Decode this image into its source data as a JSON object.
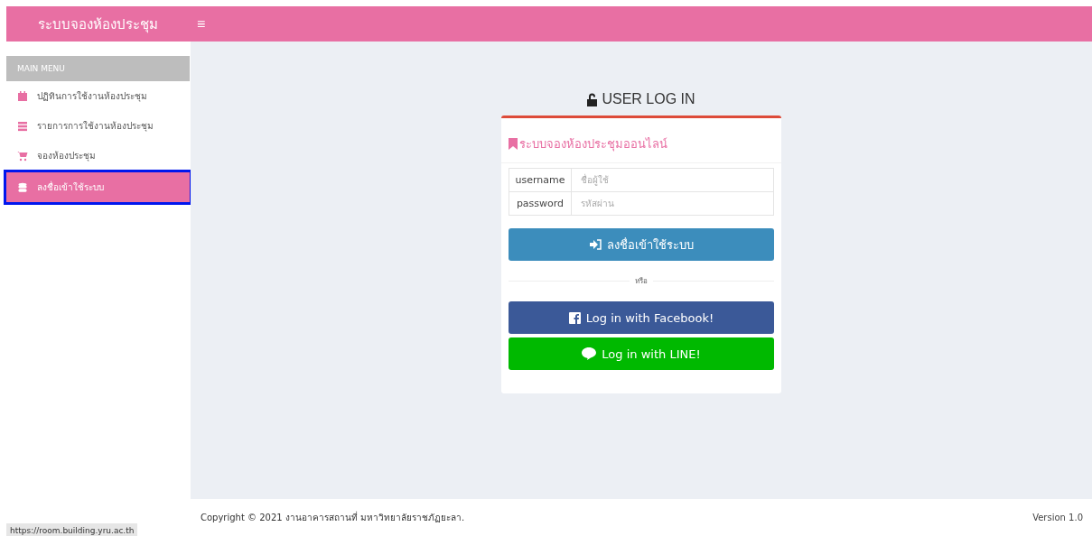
{
  "header": {
    "brand": "ระบบจองห้องประชุม",
    "menu_toggle": "≡"
  },
  "sidebar": {
    "heading": "MAIN MENU",
    "items": [
      {
        "label": "ปฏิทินการใช้งานห้องประชุม",
        "kind": "calendar",
        "selected": false
      },
      {
        "label": "รายการการใช้งานห้องประชุม",
        "kind": "list",
        "selected": false
      },
      {
        "label": "จองห้องประชุม",
        "kind": "cart",
        "selected": false
      },
      {
        "label": "ลงชื่อเข้าใช้ระบบ",
        "kind": "database",
        "selected": true
      }
    ]
  },
  "login": {
    "title": "USER LOG IN",
    "subtitle": "ระบบจองห้องประชุมออนไลน์",
    "fields": [
      {
        "label": "username",
        "placeholder": "ชื่อผู้ใช้"
      },
      {
        "label": "password",
        "placeholder": "รหัสผ่าน"
      }
    ],
    "submit": "ลงชื่อเข้าใช้ระบบ",
    "divider": "หรือ",
    "social": [
      {
        "kind": "facebook",
        "label": "Log in with Facebook!"
      },
      {
        "kind": "line",
        "label": "Log in with LINE!"
      }
    ]
  },
  "footer": {
    "copyright": "Copyright © 2021 งานอาคารสถานที่ มหาวิทยาลัยราชภัฏยะลา.",
    "version": "Version 1.0"
  },
  "status_url": "https://room.building.yru.ac.th"
}
